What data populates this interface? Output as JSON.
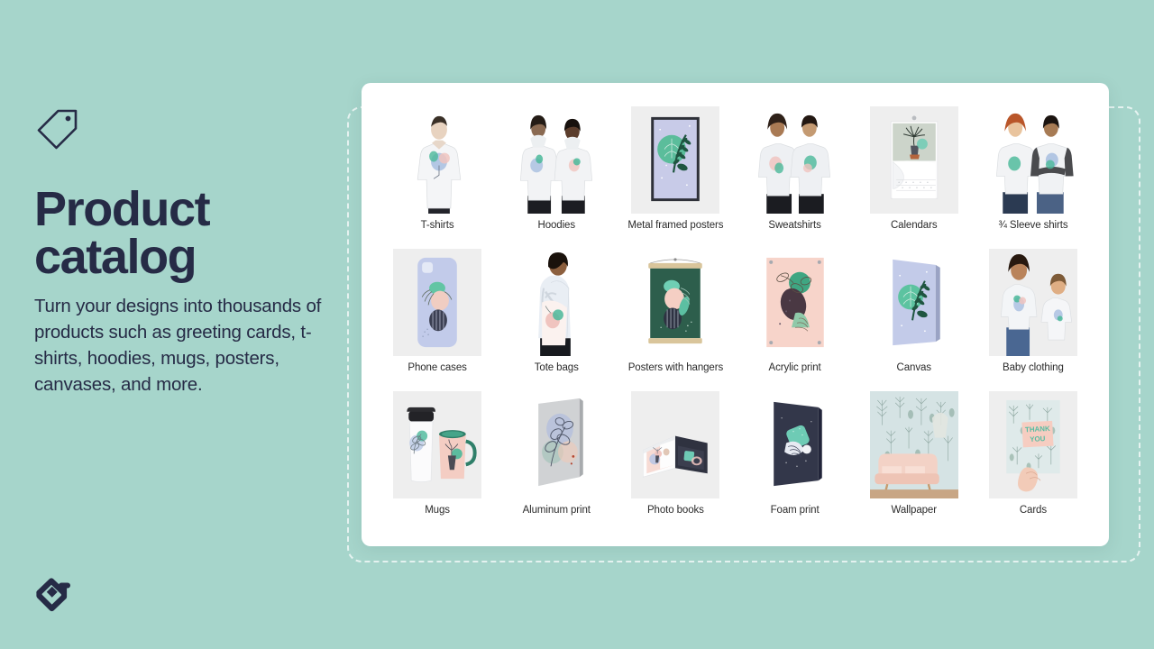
{
  "background_color": "#a6d5cb",
  "text_color": "#262b46",
  "left_panel": {
    "tag_icon": "price-tag-icon",
    "headline_line1": "Product",
    "headline_line2": "catalog",
    "subcopy": "Turn your designs into thousands of products such as greeting cards, t-shirts, hoodies, mugs, posters, canvases, and more.",
    "brand_logo": "printify-logo-icon"
  },
  "catalog": {
    "card_background": "#ffffff",
    "dashed_frame_color": "#ffffff",
    "items": [
      {
        "label": "T-shirts",
        "thumb": "tshirt-model-photo",
        "bg": "#ffffff"
      },
      {
        "label": "Hoodies",
        "thumb": "hoodie-models-photo",
        "bg": "#ffffff"
      },
      {
        "label": "Metal framed posters",
        "thumb": "framed-poster-photo",
        "bg": "#eeeeee"
      },
      {
        "label": "Sweatshirts",
        "thumb": "sweatshirt-models-photo",
        "bg": "#ffffff"
      },
      {
        "label": "Calendars",
        "thumb": "wall-calendar-photo",
        "bg": "#eeeeee"
      },
      {
        "label": "¾ Sleeve shirts",
        "thumb": "raglan-models-photo",
        "bg": "#ffffff"
      },
      {
        "label": "Phone cases",
        "thumb": "phone-case-photo",
        "bg": "#eeeeee"
      },
      {
        "label": "Tote bags",
        "thumb": "tote-bag-model-photo",
        "bg": "#ffffff"
      },
      {
        "label": "Posters with hangers",
        "thumb": "hanger-poster-photo",
        "bg": "#ffffff"
      },
      {
        "label": "Acrylic print",
        "thumb": "acrylic-print-photo",
        "bg": "#ffffff"
      },
      {
        "label": "Canvas",
        "thumb": "canvas-print-photo",
        "bg": "#ffffff"
      },
      {
        "label": "Baby clothing",
        "thumb": "kids-clothing-photo",
        "bg": "#eeeeee"
      },
      {
        "label": "Mugs",
        "thumb": "mugs-photo",
        "bg": "#eeeeee"
      },
      {
        "label": "Aluminum print",
        "thumb": "aluminum-print-photo",
        "bg": "#ffffff"
      },
      {
        "label": "Photo books",
        "thumb": "photo-book-photo",
        "bg": "#eeeeee"
      },
      {
        "label": "Foam print",
        "thumb": "foam-print-photo",
        "bg": "#ffffff"
      },
      {
        "label": "Wallpaper",
        "thumb": "wallpaper-room-photo",
        "bg": "#ffffff"
      },
      {
        "label": "Cards",
        "thumb": "greeting-card-photo",
        "bg": "#eeeeee"
      }
    ]
  }
}
